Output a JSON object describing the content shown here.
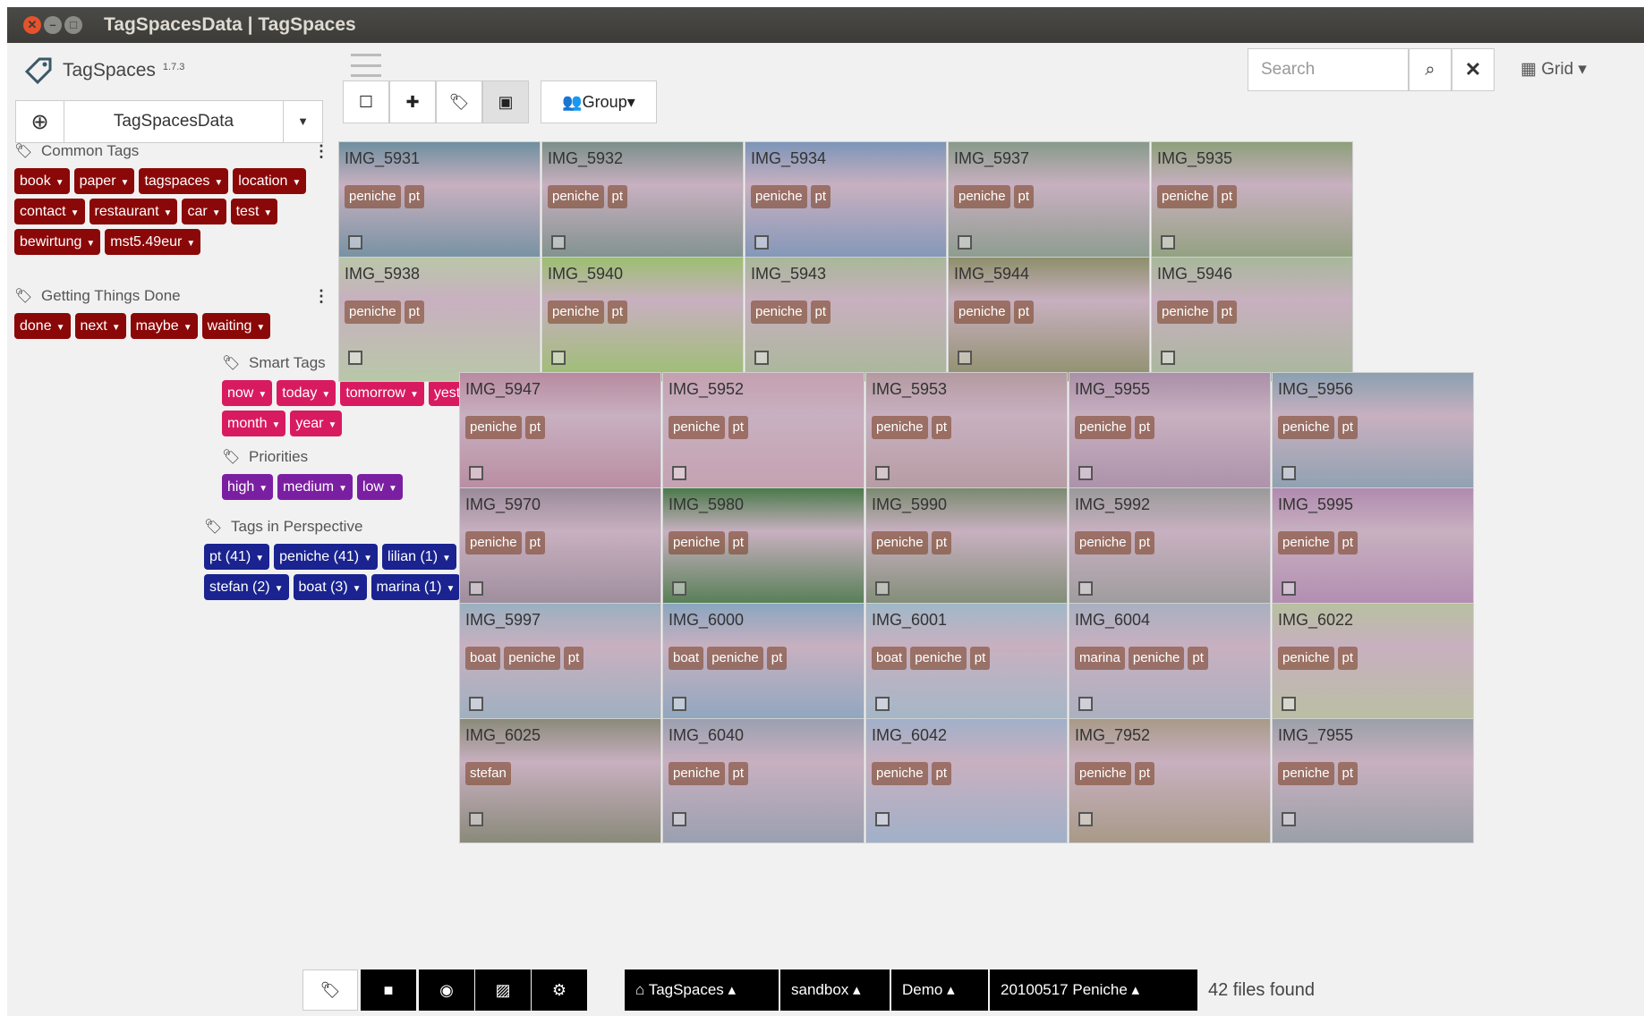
{
  "window": {
    "title": "TagSpacesData | TagSpaces"
  },
  "brand": {
    "name": "TagSpaces",
    "version": "1.7.3"
  },
  "location": {
    "name": "TagSpacesData"
  },
  "colors": {
    "red": "#8b0808",
    "pink": "#d81b60",
    "purple": "#7b1fa2",
    "blue": "#1a238f"
  },
  "tag_groups": {
    "common": {
      "title": "Common Tags",
      "tags": [
        "book",
        "paper",
        "tagspaces",
        "location",
        "contact",
        "restaurant",
        "car",
        "test",
        "bewirtung",
        "mst5.49eur"
      ]
    },
    "gtd": {
      "title": "Getting Things Done",
      "tags": [
        "done",
        "next",
        "maybe",
        "waiting"
      ]
    },
    "smart": {
      "title": "Smart Tags",
      "tags": [
        "now",
        "today",
        "tomorrow",
        "yesterday",
        "month",
        "year"
      ]
    },
    "priorities": {
      "title": "Priorities",
      "tags": [
        "high",
        "medium",
        "low"
      ]
    },
    "perspective": {
      "title": "Tags in Perspective",
      "tags": [
        "pt (41)",
        "peniche (41)",
        "lilian (1)",
        "stefan (2)",
        "boat (3)",
        "marina (1)"
      ]
    }
  },
  "toolbar": {
    "group_label": "Group",
    "search_placeholder": "Search",
    "view_label": "Grid"
  },
  "files": [
    {
      "name": "IMG_5931",
      "tags": [
        "peniche",
        "pt"
      ],
      "bg": "#6e8fa0"
    },
    {
      "name": "IMG_5932",
      "tags": [
        "peniche",
        "pt"
      ],
      "bg": "#7a8f8a"
    },
    {
      "name": "IMG_5934",
      "tags": [
        "peniche",
        "pt"
      ],
      "bg": "#7c95b8"
    },
    {
      "name": "IMG_5937",
      "tags": [
        "peniche",
        "pt"
      ],
      "bg": "#879a8a"
    },
    {
      "name": "IMG_5935",
      "tags": [
        "peniche",
        "pt"
      ],
      "bg": "#8da07a"
    },
    {
      "name": "IMG_5938",
      "tags": [
        "peniche",
        "pt"
      ],
      "bg": "#b9c7a8"
    },
    {
      "name": "IMG_5940",
      "tags": [
        "peniche",
        "pt"
      ],
      "bg": "#9cbf70"
    },
    {
      "name": "IMG_5943",
      "tags": [
        "peniche",
        "pt"
      ],
      "bg": "#a8b898"
    },
    {
      "name": "IMG_5944",
      "tags": [
        "peniche",
        "pt"
      ],
      "bg": "#8d8f6a"
    },
    {
      "name": "IMG_5946",
      "tags": [
        "peniche",
        "pt"
      ],
      "bg": "#a7b89a"
    },
    {
      "name": "IMG_5947",
      "tags": [
        "peniche",
        "pt"
      ],
      "bg": "#b88aa0"
    },
    {
      "name": "IMG_5952",
      "tags": [
        "peniche",
        "pt"
      ],
      "bg": "#c4a0b0"
    },
    {
      "name": "IMG_5953",
      "tags": [
        "peniche",
        "pt"
      ],
      "bg": "#b49aa0"
    },
    {
      "name": "IMG_5955",
      "tags": [
        "peniche",
        "pt"
      ],
      "bg": "#aa8fa8"
    },
    {
      "name": "IMG_5956",
      "tags": [
        "peniche",
        "pt"
      ],
      "bg": "#8aa0b0"
    },
    {
      "name": "IMG_5970",
      "tags": [
        "peniche",
        "pt"
      ],
      "bg": "#9a8a9a"
    },
    {
      "name": "IMG_5980",
      "tags": [
        "peniche",
        "pt"
      ],
      "bg": "#4a7a4a"
    },
    {
      "name": "IMG_5990",
      "tags": [
        "peniche",
        "pt"
      ],
      "bg": "#7a8a70"
    },
    {
      "name": "IMG_5992",
      "tags": [
        "peniche",
        "pt"
      ],
      "bg": "#9a9a9a"
    },
    {
      "name": "IMG_5995",
      "tags": [
        "peniche",
        "pt"
      ],
      "bg": "#b08ab0"
    },
    {
      "name": "IMG_5997",
      "tags": [
        "boat",
        "peniche",
        "pt"
      ],
      "bg": "#9ab0c0"
    },
    {
      "name": "IMG_6000",
      "tags": [
        "boat",
        "peniche",
        "pt"
      ],
      "bg": "#8aa6c0"
    },
    {
      "name": "IMG_6001",
      "tags": [
        "boat",
        "peniche",
        "pt"
      ],
      "bg": "#a0b8c8"
    },
    {
      "name": "IMG_6004",
      "tags": [
        "marina",
        "peniche",
        "pt"
      ],
      "bg": "#a8b0c0"
    },
    {
      "name": "IMG_6022",
      "tags": [
        "peniche",
        "pt"
      ],
      "bg": "#b8c0a0"
    },
    {
      "name": "IMG_6025",
      "tags": [
        "stefan"
      ],
      "bg": "#8a8a7a"
    },
    {
      "name": "IMG_6040",
      "tags": [
        "peniche",
        "pt"
      ],
      "bg": "#9aa0b0"
    },
    {
      "name": "IMG_6042",
      "tags": [
        "peniche",
        "pt"
      ],
      "bg": "#a0b0c8"
    },
    {
      "name": "IMG_7952",
      "tags": [
        "peniche",
        "pt"
      ],
      "bg": "#a89a88"
    },
    {
      "name": "IMG_7955",
      "tags": [
        "peniche",
        "pt"
      ],
      "bg": "#9aa0a8"
    }
  ],
  "perspectives": [
    {
      "icon": "tag-icon"
    },
    {
      "icon": "folder-icon"
    },
    {
      "icon": "eye-icon"
    },
    {
      "icon": "image-icon"
    },
    {
      "icon": "gear-icon"
    }
  ],
  "breadcrumb": {
    "location": "TagSpaces",
    "items": [
      "sandbox",
      "Demo",
      "20100517 Peniche"
    ]
  },
  "status": {
    "files_found": "42 files found"
  }
}
